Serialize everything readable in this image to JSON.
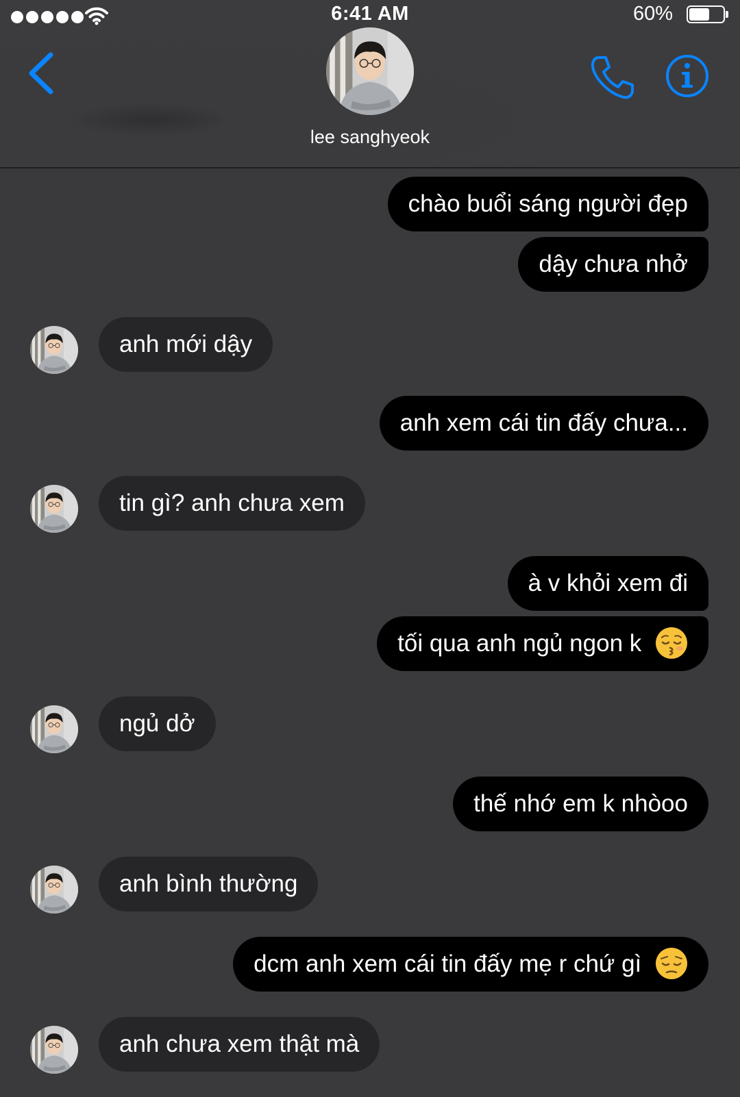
{
  "status_bar": {
    "time": "6:41 AM",
    "battery_percent": "60%",
    "battery_level": 0.6,
    "signal_dots": 5
  },
  "header": {
    "contact_name": "lee sanghyeok",
    "icons": {
      "back": "chevron-left-icon",
      "call": "phone-icon",
      "info": "info-icon"
    },
    "accent_color": "#0a84ff"
  },
  "messages": [
    {
      "sender": "me",
      "text": "chào buổi sáng người đẹp"
    },
    {
      "sender": "me",
      "text": "dậy chưa nhở"
    },
    {
      "sender": "contact",
      "text": "anh mới dậy"
    },
    {
      "sender": "me",
      "text": "anh xem cái tin đấy chưa..."
    },
    {
      "sender": "contact",
      "text": "tin gì? anh chưa xem"
    },
    {
      "sender": "me",
      "text": "à v khỏi xem đi"
    },
    {
      "sender": "me",
      "text": "tối qua anh ngủ ngon k",
      "emoji": "kissing-face-closed-eyes"
    },
    {
      "sender": "contact",
      "text": "ngủ dở"
    },
    {
      "sender": "me",
      "text": "thế nhớ em k nhòoo"
    },
    {
      "sender": "contact",
      "text": "anh bình thường"
    },
    {
      "sender": "me",
      "text": "dcm anh xem cái tin đấy mẹ r chứ gì",
      "emoji": "pensive-face"
    },
    {
      "sender": "contact",
      "text": "anh chưa xem thật mà"
    }
  ],
  "colors": {
    "background": "#3a3a3c",
    "sent_bubble": "#000000",
    "received_bubble": "#262628",
    "text": "#ffffff"
  }
}
